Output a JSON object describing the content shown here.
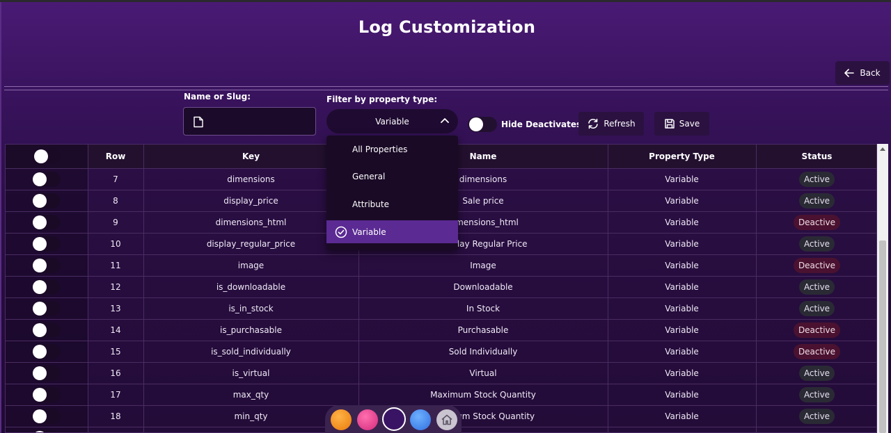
{
  "page": {
    "title": "Log Customization"
  },
  "header": {
    "back_label": "Back"
  },
  "filters": {
    "name_label": "Name or Slug:",
    "name_value": "",
    "filter_label": "Filter by property type:",
    "filter_value": "Variable",
    "hide_deactivates_label": "Hide Deactivates",
    "refresh_label": "Refresh",
    "save_label": "Save"
  },
  "dropdown": {
    "options": [
      "All Properties",
      "General",
      "Attribute",
      "Variable"
    ],
    "selected": "Variable"
  },
  "table": {
    "columns": [
      "",
      "Row",
      "Key",
      "Name",
      "Property Type",
      "Status"
    ],
    "rows": [
      {
        "row": "7",
        "key": "dimensions",
        "name": "dimensions",
        "type": "Variable",
        "status": "Active"
      },
      {
        "row": "8",
        "key": "display_price",
        "name": "Sale price",
        "type": "Variable",
        "status": "Active"
      },
      {
        "row": "9",
        "key": "dimensions_html",
        "name": "dimensions_html",
        "type": "Variable",
        "status": "Deactive"
      },
      {
        "row": "10",
        "key": "display_regular_price",
        "name": "Display Regular Price",
        "type": "Variable",
        "status": "Active"
      },
      {
        "row": "11",
        "key": "image",
        "name": "Image",
        "type": "Variable",
        "status": "Deactive"
      },
      {
        "row": "12",
        "key": "is_downloadable",
        "name": "Downloadable",
        "type": "Variable",
        "status": "Active"
      },
      {
        "row": "13",
        "key": "is_in_stock",
        "name": "In Stock",
        "type": "Variable",
        "status": "Active"
      },
      {
        "row": "14",
        "key": "is_purchasable",
        "name": "Purchasable",
        "type": "Variable",
        "status": "Deactive"
      },
      {
        "row": "15",
        "key": "is_sold_individually",
        "name": "Sold Individually",
        "type": "Variable",
        "status": "Deactive"
      },
      {
        "row": "16",
        "key": "is_virtual",
        "name": "Virtual",
        "type": "Variable",
        "status": "Active"
      },
      {
        "row": "17",
        "key": "max_qty",
        "name": "Maximum Stock Quantity",
        "type": "Variable",
        "status": "Active"
      },
      {
        "row": "18",
        "key": "min_qty",
        "name": "Minimum Stock Quantity",
        "type": "Variable",
        "status": "Active"
      },
      {
        "row": "",
        "key": "",
        "name": "",
        "type": "",
        "status": ""
      }
    ]
  },
  "colors": {
    "accent": "#5b2a93",
    "active_badge": "#2a2a35",
    "deactive_badge": "#4a1230",
    "dock_orange": "#e97a0a",
    "dock_pink": "#d32a7c",
    "dock_purple": "#3a1464",
    "dock_blue": "#2f6fe0",
    "dock_gray": "#c9c4cf"
  },
  "dock": {
    "icons": [
      "orange-theme-icon",
      "pink-theme-icon",
      "purple-theme-icon",
      "blue-theme-icon",
      "home-icon"
    ]
  }
}
